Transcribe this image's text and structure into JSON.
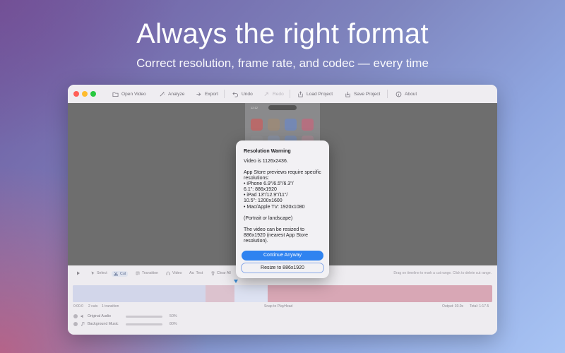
{
  "hero": {
    "title": "Always the right format",
    "subtitle": "Correct resolution, frame rate, and codec — every time"
  },
  "toolbar": {
    "open_video": "Open Video",
    "analyze": "Analyze",
    "export": "Export",
    "undo": "Undo",
    "redo": "Redo",
    "load_project": "Load Project",
    "save_project": "Save Project",
    "about": "About"
  },
  "editor_controls": {
    "select": "Select",
    "cut": "Cut",
    "transition": "Transition",
    "video": "Video",
    "text": "Text",
    "clear_all": "Clear All",
    "hint": "Drag on timeline to mark a cut range. Click to delete cut range."
  },
  "timeline_info": {
    "time": "0:00.0",
    "cuts": "2 cuts",
    "transitions": "1 transition",
    "snap": "Snap to PlayHead",
    "output": "Output: 30.0s",
    "total": "Total: 1:17.5"
  },
  "audio_tracks": [
    {
      "label": "Original Audio",
      "level": "50%"
    },
    {
      "label": "Background Music",
      "level": "80%"
    }
  ],
  "phone_preview": {
    "time": "12:12"
  },
  "dialog": {
    "title": "Resolution Warning",
    "line1": "Video is 1126x2436.",
    "body": "App Store previews require specific\nresolutions:\n• iPhone 6.9\"/6.5\"/6.3\"/\n6.1\": 886x1920\n• iPad 13\"/12.9\"/11\"/\n10.5\": 1200x1600\n• Mac/Apple TV: 1920x1080",
    "note": "(Portrait or landscape)",
    "resize_note": "The video can be resized to\n886x1920 (nearest App Store\nresolution).",
    "continue_label": "Continue Anyway",
    "resize_label": "Resize to 886x1920"
  },
  "colors": {
    "accent": "#2f83f0",
    "close": "#ff5f57",
    "minimize": "#febc2e",
    "zoom": "#28c840"
  }
}
